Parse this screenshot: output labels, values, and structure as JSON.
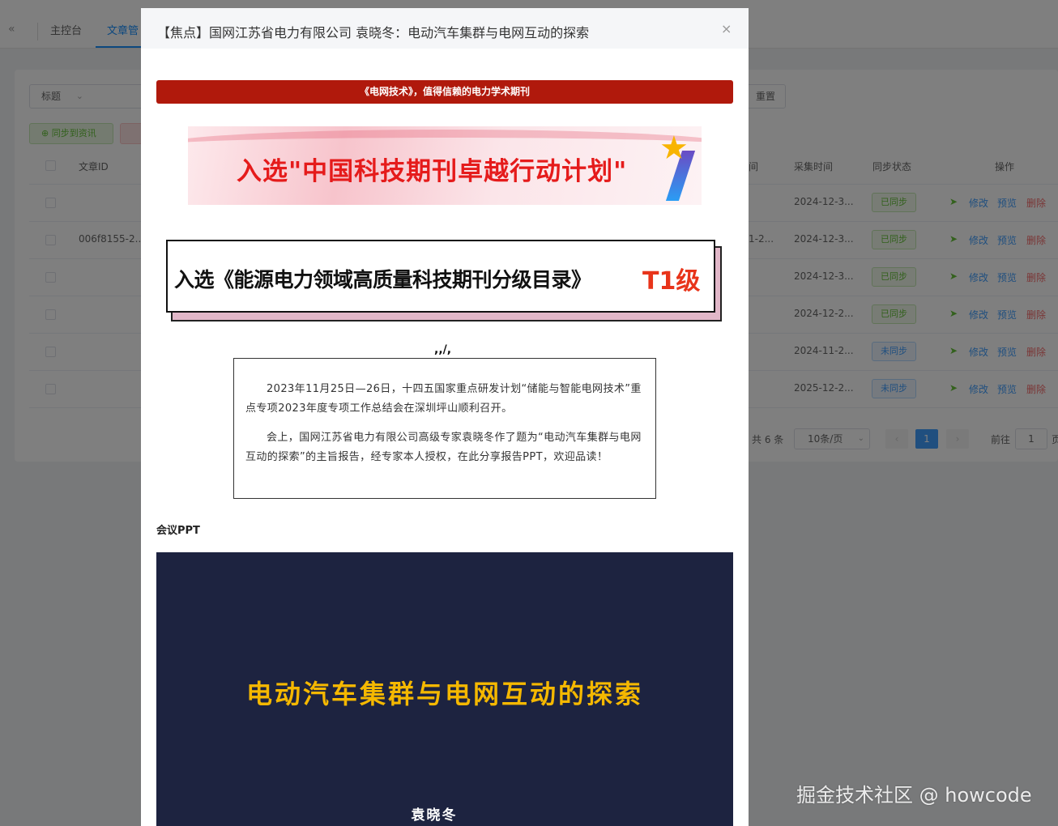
{
  "background": {
    "back_icon": "double-chevron-left-icon",
    "tabs": [
      {
        "label": "主控台"
      },
      {
        "label": "文章管"
      }
    ],
    "filter": {
      "field_select": "标题",
      "reset_label": "重置"
    },
    "actions": {
      "sync_label": "同步到资讯"
    },
    "table": {
      "headers": {
        "id": "文章ID",
        "col_partial": "间",
        "collected": "采集时间",
        "sync_status": "同步状态",
        "ops": "操作"
      },
      "rows": [
        {
          "id": "",
          "partial": "",
          "collected": "2024-12-3...",
          "status": "已同步",
          "ok": true
        },
        {
          "id": "006f8155-2...",
          "partial": "1-2...",
          "collected": "2024-12-3...",
          "status": "已同步",
          "ok": true
        },
        {
          "id": "",
          "partial": "",
          "collected": "2024-12-3...",
          "status": "已同步",
          "ok": true
        },
        {
          "id": "",
          "partial": "",
          "collected": "2024-12-2...",
          "status": "已同步",
          "ok": true
        },
        {
          "id": "",
          "partial": "",
          "collected": "2024-11-2...",
          "status": "未同步",
          "ok": false
        },
        {
          "id": "",
          "partial": "",
          "collected": "2025-12-2...",
          "status": "未同步",
          "ok": false
        }
      ],
      "row_actions": {
        "edit": "修改",
        "preview": "预览",
        "delete": "删除",
        "send_icon": "send-icon"
      }
    },
    "pager": {
      "total": "共 6 条",
      "size": "10条/页",
      "current": "1",
      "goto": "前往",
      "goto_value": "1",
      "page_suffix": "页"
    }
  },
  "dialog": {
    "title": "【焦点】国网江苏省电力有限公司 袁晓冬：电动汽车集群与电网互动的探索",
    "close_icon": "×",
    "red_bar": "《电网技术》，值得信赖的电力学术期刊",
    "banner1": "入选\"中国科技期刊卓越行动计划\"",
    "banner2_text": "入选《能源电力领域高质量科技期刊分级目录》",
    "banner2_badge": "T1级",
    "paragraph1": "2023年11月25日—26日，十四五国家重点研发计划“储能与智能电网技术”重点专项2023年度专项工作总结会在深圳坪山顺利召开。",
    "paragraph2": "会上，国网江苏省电力有限公司高级专家袁晓冬作了题为“电动汽车集群与电网互动的探索”的主旨报告，经专家本人授权，在此分享报告PPT，欢迎品读！",
    "section_label": "会议PPT",
    "ppt_title": "电动汽车集群与电网互动的探索",
    "ppt_author": "袁晓冬"
  },
  "watermark": "掘金技术社区 @ howcode"
}
